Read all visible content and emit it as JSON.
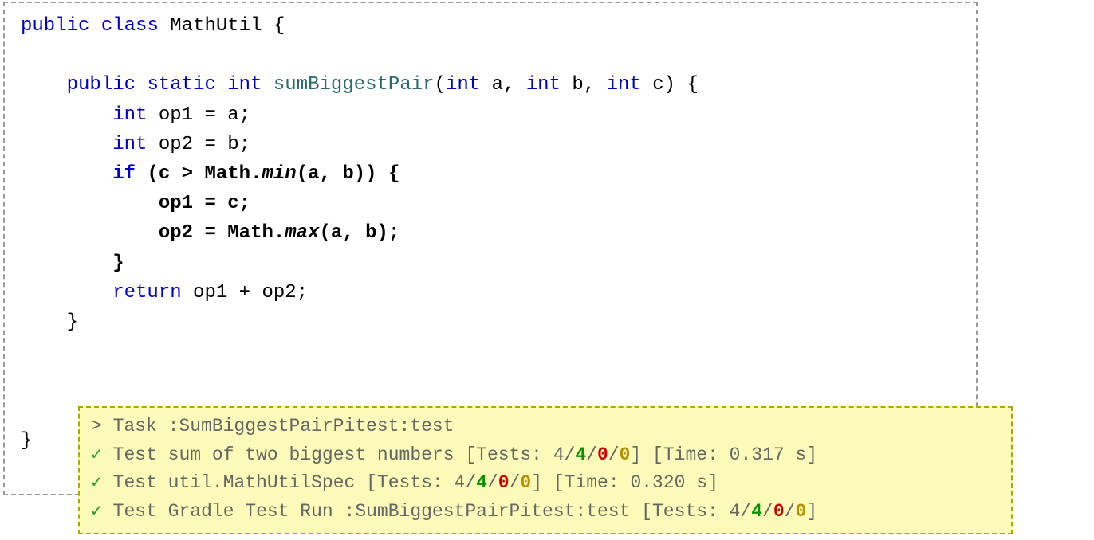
{
  "code": {
    "tokens": {
      "public": "public",
      "class": "class",
      "className": "MathUtil",
      "obrace": "{",
      "cbrace": "}",
      "static": "static",
      "int": "int",
      "method": "sumBiggestPair",
      "oparen": "(",
      "cparen": ")",
      "comma": ",",
      "a": "a",
      "b": "b",
      "c": "c",
      "op1": "op1",
      "op2": "op2",
      "eq": "=",
      "semi": ";",
      "if": "if",
      "gt": ">",
      "math": "Math",
      "dot": ".",
      "min": "min",
      "max": "max",
      "return": "return",
      "plus": "+"
    }
  },
  "test": {
    "task_line": "> Task :SumBiggestPairPitest:test",
    "lines": [
      {
        "pre": "Test sum of two biggest numbers [Tests: ",
        "total": "4",
        "pass": "4",
        "fail": "0",
        "skip": "0",
        "post": "] [Time: 0.317 s]"
      },
      {
        "pre": "Test util.MathUtilSpec [Tests: ",
        "total": "4",
        "pass": "4",
        "fail": "0",
        "skip": "0",
        "post": "] [Time: 0.320 s]"
      },
      {
        "pre": "Test Gradle Test Run :SumBiggestPairPitest:test [Tests: ",
        "total": "4",
        "pass": "4",
        "fail": "0",
        "skip": "0",
        "post": "]"
      }
    ],
    "check": "✓"
  }
}
